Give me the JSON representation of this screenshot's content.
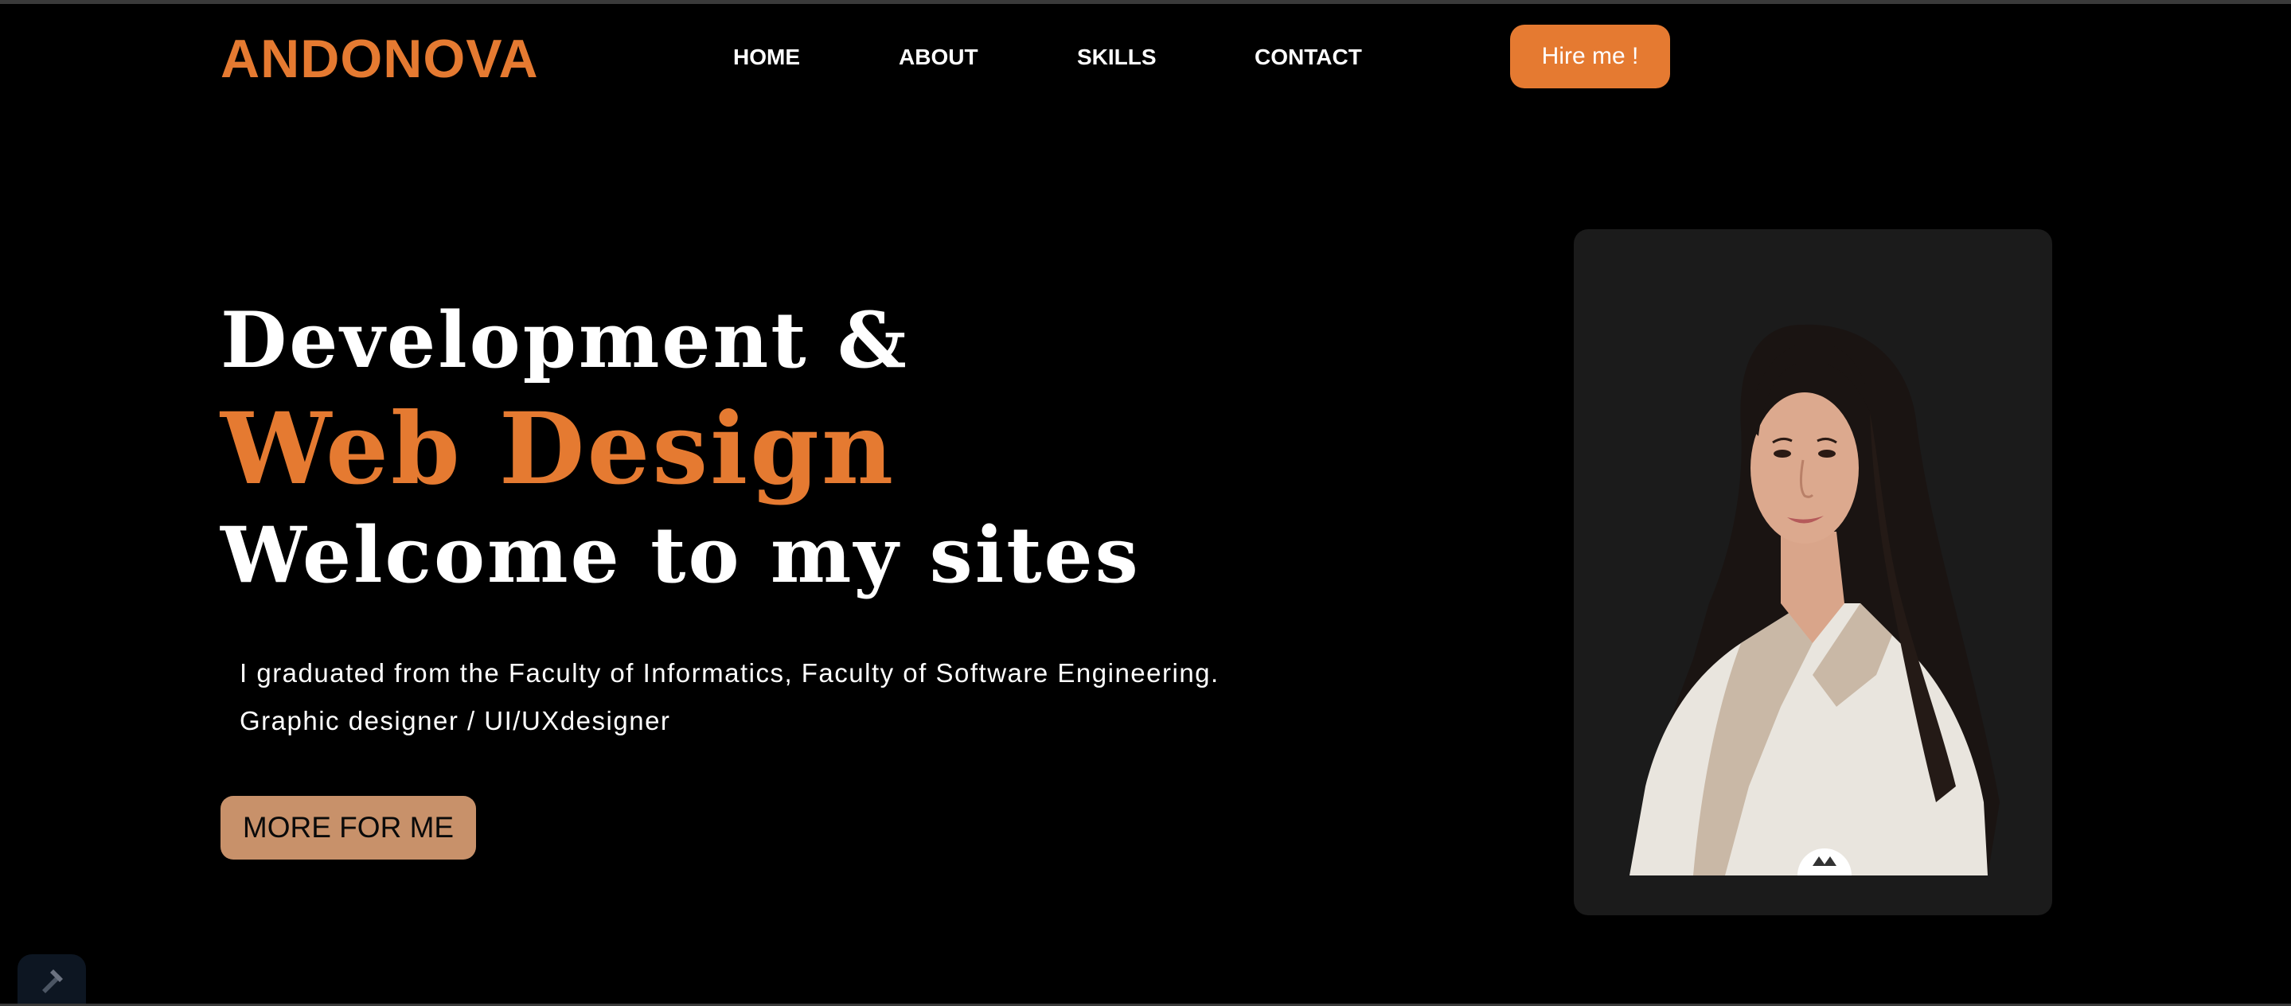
{
  "header": {
    "logo": "ANDONOVA",
    "nav": [
      {
        "label": "HOME"
      },
      {
        "label": "ABOUT"
      },
      {
        "label": "SKILLS"
      },
      {
        "label": "CONTACT"
      }
    ],
    "hire_button": "Hire me !"
  },
  "hero": {
    "line1": "Development &",
    "line2": "Web Design",
    "line3": "Welcome to my sites",
    "description": [
      "I graduated from the Faculty of Informatics, Faculty of Software Engineering.",
      "Graphic designer / UI/UXdesigner"
    ],
    "cta_button": "MORE FOR ME"
  },
  "colors": {
    "background": "#000000",
    "accent": "#e57a31",
    "cta": "#c8916a",
    "card": "#1b1b1b"
  },
  "icons": {
    "widget": "pen-icon"
  }
}
